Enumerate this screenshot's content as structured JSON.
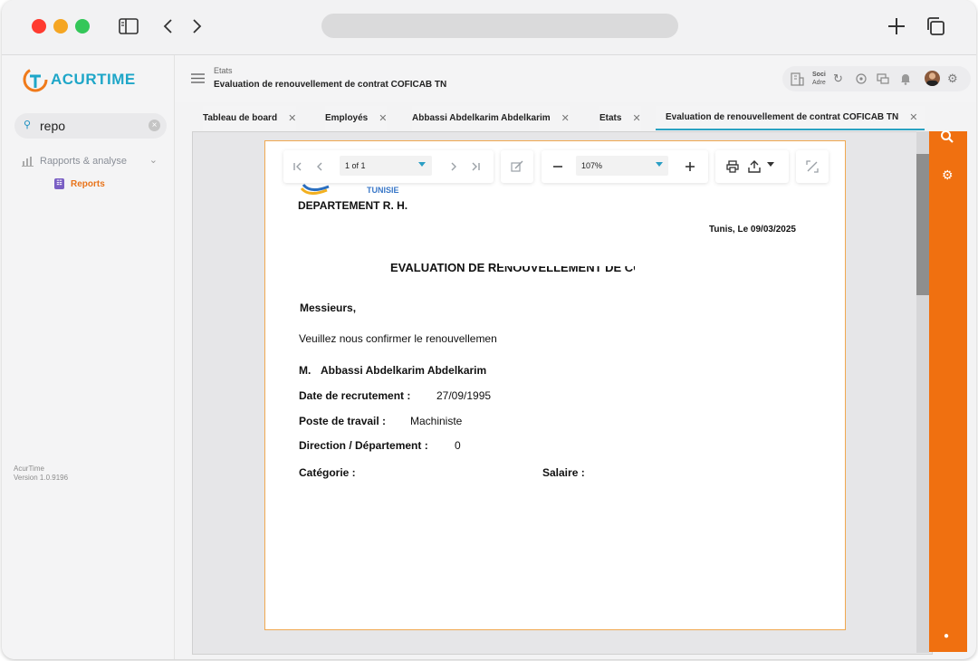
{
  "app": {
    "logo_text": "ACURTIME",
    "version_name": "AcurTime",
    "version_number": "Version 1.0.9196"
  },
  "sidebar": {
    "search_value": "repo",
    "group_label": "Rapports & analyse",
    "item_label": "Reports"
  },
  "header": {
    "crumb_parent": "Etats",
    "crumb_title": "Evaluation de renouvellement de contrat COFICAB TN",
    "company_line1": "Soci",
    "company_line2": "Adre"
  },
  "tabs": [
    {
      "label": "Tableau de board"
    },
    {
      "label": "Employés"
    },
    {
      "label": "Abbassi Abdelkarim Abdelkarim"
    },
    {
      "label": "Etats"
    },
    {
      "label": "Evaluation de renouvellement de contrat COFICAB TN"
    }
  ],
  "viewer": {
    "page_indicator": "1 of 1",
    "zoom": "107%"
  },
  "document": {
    "logo_sub": "TUNISIE",
    "department": "DEPARTEMENT R. H.",
    "date_line": "Tunis, Le 09/03/2025",
    "title": "EVALUATION DE RENOUVELLEMENT DE CONTRAT",
    "salutation": "Messieurs,",
    "body": "Veuillez nous confirmer le renouvellemen",
    "employee_prefix": "M.",
    "employee_name": "Abbassi Abdelkarim Abdelkarim",
    "recruit_label": "Date de recrutement :",
    "recruit_value": "27/09/1995",
    "post_label": "Poste de travail :",
    "post_value": "Machiniste",
    "direction_label": "Direction / Département :",
    "direction_value": "0",
    "category_label": "Catégorie :",
    "salary_label": "Salaire :"
  },
  "colors": {
    "accent_orange": "#f07010",
    "accent_blue": "#2aa2c2",
    "doc_border": "#f0a850"
  }
}
